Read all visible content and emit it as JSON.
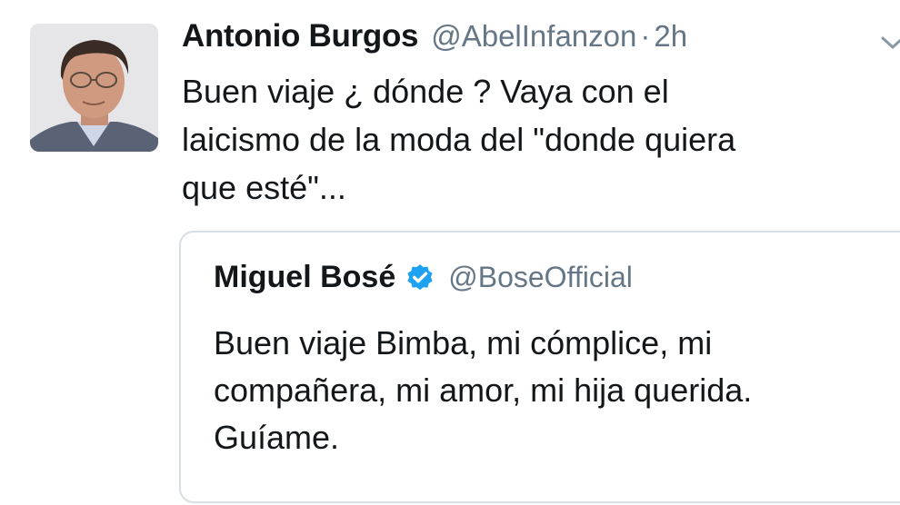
{
  "tweet": {
    "author_name": "Antonio Burgos",
    "author_handle": "@AbelInfanzon",
    "separator": "·",
    "timestamp": "2h",
    "text": "Buen viaje ¿ dónde ? Vaya con el\nlaicismo de la moda del \"donde quiera\nque esté\"...",
    "avatar_icon": "person-portrait",
    "menu_icon": "chevron-down-icon"
  },
  "quoted_tweet": {
    "author_name": "Miguel Bosé",
    "verified_icon": "verified-badge-icon",
    "author_handle": "@BoseOfficial",
    "text": "Buen viaje Bimba, mi cómplice, mi\ncompañera, mi amor, mi hija querida.\nGuíame."
  },
  "colors": {
    "text_primary": "#14171a",
    "text_secondary": "#657786",
    "verified_blue": "#1da1f2",
    "border": "#d8dfe4"
  }
}
